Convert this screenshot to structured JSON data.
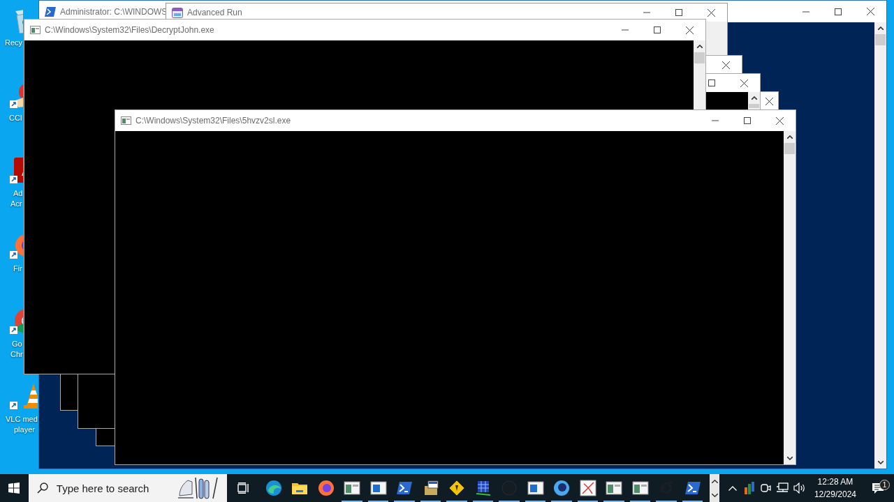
{
  "desktop": {
    "icons": [
      {
        "label_lines": [
          "Recy"
        ]
      },
      {
        "label_lines": [
          "CCl"
        ]
      },
      {
        "label_lines": [
          "Ad",
          "Acr"
        ]
      },
      {
        "label_lines": [
          "Fir"
        ]
      },
      {
        "label_lines": [
          "Go",
          "Chr"
        ]
      },
      {
        "label_lines": [
          "VLC med",
          "player"
        ]
      }
    ]
  },
  "windows": [
    {
      "kind": "powershell",
      "title": "Administrator: C:\\WINDOWS"
    },
    {
      "kind": "dialog",
      "title": "Advanced Run"
    },
    {
      "kind": "console"
    },
    {
      "kind": "console"
    },
    {
      "kind": "console"
    },
    {
      "kind": "console",
      "title": "C:\\Windows\\System32\\Files\\DecryptJohn.exe"
    },
    {
      "kind": "console",
      "title": "C:\\Windows\\System32\\Files\\5hvzv2sl.exe"
    }
  ],
  "taskbar": {
    "search": {
      "placeholder": "Type here to search"
    },
    "apps": [
      {
        "running": false
      },
      {
        "running": false
      },
      {
        "running": false
      },
      {
        "running": true
      },
      {
        "running": true
      },
      {
        "running": true
      },
      {
        "running": true
      },
      {
        "running": true
      },
      {
        "running": true
      },
      {
        "running": true
      },
      {
        "running": true
      },
      {
        "running": true
      },
      {
        "running": true
      },
      {
        "running": true
      },
      {
        "running": true
      },
      {
        "running": true
      },
      {
        "running": true
      }
    ],
    "clock": {
      "time": "12:28 AM",
      "date": "12/29/2024"
    },
    "notifications": {
      "count": "1"
    }
  }
}
